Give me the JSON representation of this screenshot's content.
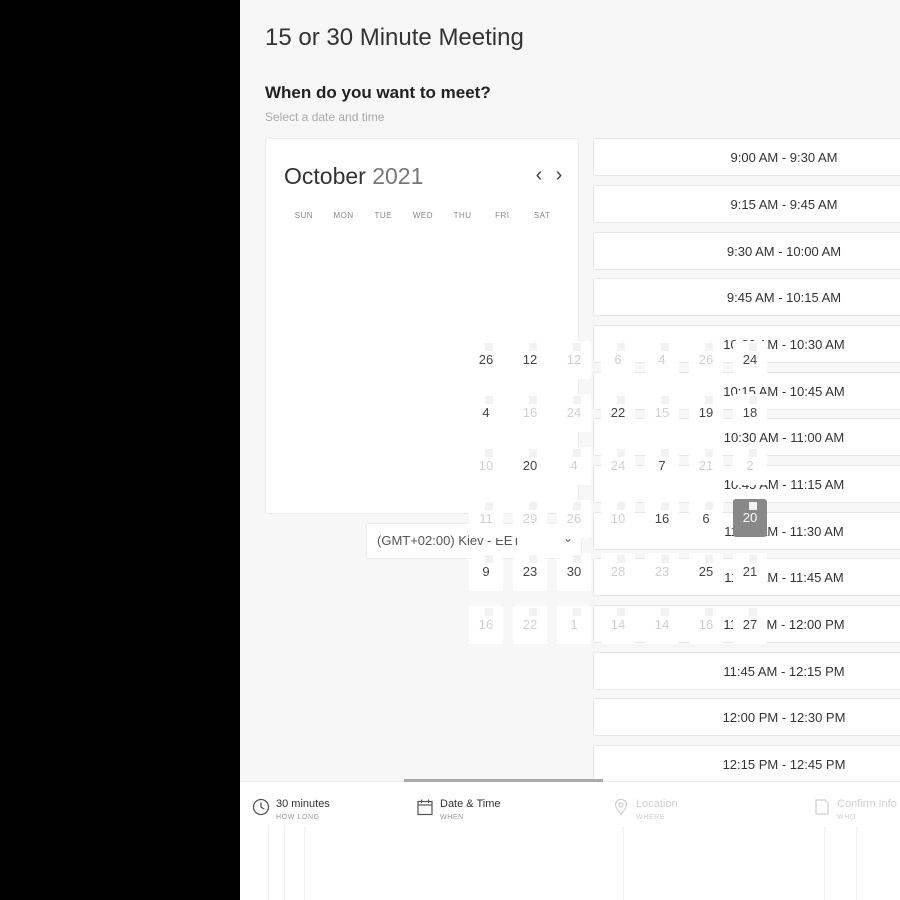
{
  "meeting": {
    "title": "15 or 30 Minute Meeting",
    "question": "When do you want to meet?",
    "hint": "Select a date and time"
  },
  "calendar": {
    "month": "October",
    "year": "2021",
    "prev_icon": "chevron-left-icon",
    "next_icon": "chevron-right-icon",
    "weekdays": [
      "SUN",
      "MON",
      "TUE",
      "WED",
      "THU",
      "FRI",
      "SAT"
    ],
    "selected_day": "20"
  },
  "timezone": {
    "value": "(GMT+02:00) Kiev - EET",
    "icon": "chevron-down-icon"
  },
  "time_slots": [
    "9:00 AM - 9:30 AM",
    "9:15 AM - 9:45 AM",
    "9:30 AM - 10:00 AM",
    "9:45 AM - 10:15 AM",
    "10:00 AM - 10:30 AM",
    "10:15 AM - 10:45 AM",
    "10:30 AM - 11:00 AM",
    "10:45 AM - 11:15 AM",
    "11:00 AM - 11:30 AM",
    "11:15 AM - 11:45 AM",
    "11:30 AM - 12:00 PM",
    "11:45 AM - 12:15 PM",
    "12:00 PM - 12:30 PM",
    "12:15 PM - 12:45 PM"
  ],
  "date_cells": [
    {
      "text": "26",
      "muted": false
    },
    {
      "text": "12",
      "muted": false
    },
    {
      "text": "12",
      "muted": true
    },
    {
      "text": "6",
      "muted": true
    },
    {
      "text": "4",
      "muted": true
    },
    {
      "text": "26",
      "muted": true
    },
    {
      "text": "24",
      "muted": false
    },
    {
      "text": "4",
      "muted": false
    },
    {
      "text": "16",
      "muted": true
    },
    {
      "text": "24",
      "muted": true
    },
    {
      "text": "22",
      "muted": false
    },
    {
      "text": "15",
      "muted": true
    },
    {
      "text": "19",
      "muted": false
    },
    {
      "text": "18",
      "muted": false
    },
    {
      "text": "10",
      "muted": true
    },
    {
      "text": "20",
      "muted": false
    },
    {
      "text": "4",
      "muted": true
    },
    {
      "text": "24",
      "muted": true
    },
    {
      "text": "7",
      "muted": false
    },
    {
      "text": "21",
      "muted": true
    },
    {
      "text": "2",
      "muted": true
    },
    {
      "text": "11",
      "muted": true
    },
    {
      "text": "29",
      "muted": true
    },
    {
      "text": "26",
      "muted": true
    },
    {
      "text": "10",
      "muted": true
    },
    {
      "text": "16",
      "muted": false
    },
    {
      "text": "6",
      "muted": false
    },
    {
      "text": "20",
      "muted": false,
      "selected": true
    },
    {
      "text": "9",
      "muted": false
    },
    {
      "text": "23",
      "muted": false
    },
    {
      "text": "30",
      "muted": false
    },
    {
      "text": "28",
      "muted": true
    },
    {
      "text": "23",
      "muted": true
    },
    {
      "text": "25",
      "muted": false
    },
    {
      "text": "21",
      "muted": false
    },
    {
      "text": "16",
      "muted": true
    },
    {
      "text": "22",
      "muted": true
    },
    {
      "text": "1",
      "muted": true
    },
    {
      "text": "14",
      "muted": true
    },
    {
      "text": "14",
      "muted": true
    },
    {
      "text": "16",
      "muted": true
    },
    {
      "text": "27",
      "muted": false
    }
  ],
  "tabs": [
    {
      "label": "30 minutes",
      "sub": "HOW LONG",
      "icon": "clock-icon"
    },
    {
      "label": "Date & Time",
      "sub": "WHEN",
      "icon": "calendar-icon"
    },
    {
      "label": "Location",
      "sub": "WHERE",
      "icon": "location-pin-icon"
    },
    {
      "label": "Confirm Info",
      "sub": "WHO",
      "icon": "document-icon"
    }
  ]
}
